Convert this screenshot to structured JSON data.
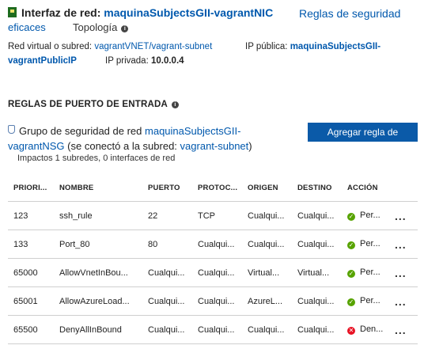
{
  "nic": {
    "label": "Interfaz de red:",
    "name": "maquinaSubjectsGII-vagrantNIC",
    "security_rules_link": "Reglas de seguridad",
    "effective_link": "eficaces",
    "topology_label": "Topología"
  },
  "details": {
    "vnet_label": "Red virtual o subred:",
    "vnet_value": "vagrantVNET/vagrant-subnet",
    "public_ip_label": "IP pública:",
    "public_ip_value_1": "maquinaSubjectsGII-",
    "public_ip_value_2": "vagrantPublicIP",
    "private_ip_label": "IP privada:",
    "private_ip_value": "10.0.0.4"
  },
  "inbound": {
    "title": "REGLAS DE PUERTO DE ENTRADA",
    "nsg_prefix": "Grupo de seguridad de red",
    "nsg_name_1": "maquinaSubjectsGII-",
    "nsg_name_2": "vagrantNSG",
    "nsg_middle": "(se conectó a la subred:",
    "nsg_subnet": "vagrant-subnet",
    "nsg_suffix": ")",
    "impacts": "Impactos 1 subredes, 0 interfaces de red",
    "add_button": "Agregar regla de",
    "columns": [
      "PRIORI...",
      "NOMBRE",
      "PUERTO",
      "PROTOC...",
      "ORIGEN",
      "DESTINO",
      "ACCIÓN"
    ],
    "rows": [
      {
        "priority": "123",
        "name": "ssh_rule",
        "port": "22",
        "protocol": "TCP",
        "source": "Cualqui...",
        "dest": "Cualqui...",
        "action": "Per...",
        "status": "allow"
      },
      {
        "priority": "133",
        "name": "Port_80",
        "port": "80",
        "protocol": "Cualqui...",
        "source": "Cualqui...",
        "dest": "Cualqui...",
        "action": "Per...",
        "status": "allow"
      },
      {
        "priority": "65000",
        "name": "AllowVnetInBou...",
        "port": "Cualqui...",
        "protocol": "Cualqui...",
        "source": "Virtual...",
        "dest": "Virtual...",
        "action": "Per...",
        "status": "allow"
      },
      {
        "priority": "65001",
        "name": "AllowAzureLoad...",
        "port": "Cualqui...",
        "protocol": "Cualqui...",
        "source": "AzureL...",
        "dest": "Cualqui...",
        "action": "Per...",
        "status": "allow"
      },
      {
        "priority": "65500",
        "name": "DenyAllInBound",
        "port": "Cualqui...",
        "protocol": "Cualqui...",
        "source": "Cualqui...",
        "dest": "Cualqui...",
        "action": "Den...",
        "status": "deny"
      }
    ],
    "more_label": "...",
    "colors": {
      "allow": "#57a300",
      "deny": "#e81123",
      "link": "#0058ad",
      "button": "#0b5aa8"
    }
  }
}
